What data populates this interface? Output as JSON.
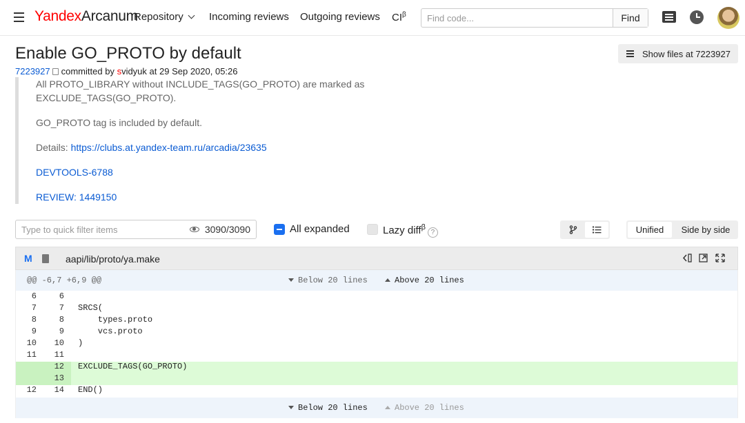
{
  "header": {
    "logo_brand": "Yandex",
    "logo_product": "Arcanum",
    "nav": [
      "Repository",
      "Incoming reviews",
      "Outgoing reviews",
      "CI"
    ],
    "ci_sup": "β",
    "search_placeholder": "Find code...",
    "find_label": "Find"
  },
  "commit": {
    "title": "Enable GO_PROTO by default",
    "hash": "7223927",
    "committed_by": "committed by",
    "author_first": "s",
    "author_rest": "vidyuk",
    "date": "at 29 Sep 2020, 05:26",
    "show_files_label": "Show files at 7223927",
    "message": {
      "line1": "All PROTO_LIBRARY without INCLUDE_TAGS(GO_PROTO) are marked as",
      "line2": "EXCLUDE_TAGS(GO_PROTO).",
      "line3": "GO_PROTO tag is included by default.",
      "details_label": "Details: ",
      "details_link": "https://clubs.at.yandex-team.ru/arcadia/23635",
      "ticket": "DEVTOOLS-6788",
      "review": "REVIEW: 1449150"
    }
  },
  "filter": {
    "placeholder": "Type to quick filter items",
    "count": "3090/3090",
    "all_expanded_label": "All expanded",
    "lazy_diff_label": "Lazy diff",
    "lazy_sup": "β",
    "help": "?",
    "view_unified": "Unified",
    "view_side": "Side by side"
  },
  "file": {
    "status": "M",
    "path": "aapi/lib/proto/ya.make",
    "hunk_header": "@@ -6,7 +6,9 @@",
    "below_label": "Below 20 lines",
    "above_label": "Above 20 lines",
    "lines": [
      {
        "l": "6",
        "r": "6",
        "code": ""
      },
      {
        "l": "7",
        "r": "7",
        "code": "SRCS("
      },
      {
        "l": "8",
        "r": "8",
        "code": "    types.proto"
      },
      {
        "l": "9",
        "r": "9",
        "code": "    vcs.proto"
      },
      {
        "l": "10",
        "r": "10",
        "code": ")"
      },
      {
        "l": "11",
        "r": "11",
        "code": ""
      },
      {
        "l": "",
        "r": "12",
        "code": "EXCLUDE_TAGS(GO_PROTO)"
      },
      {
        "l": "",
        "r": "13",
        "code": ""
      },
      {
        "l": "12",
        "r": "14",
        "code": "END()"
      }
    ]
  }
}
